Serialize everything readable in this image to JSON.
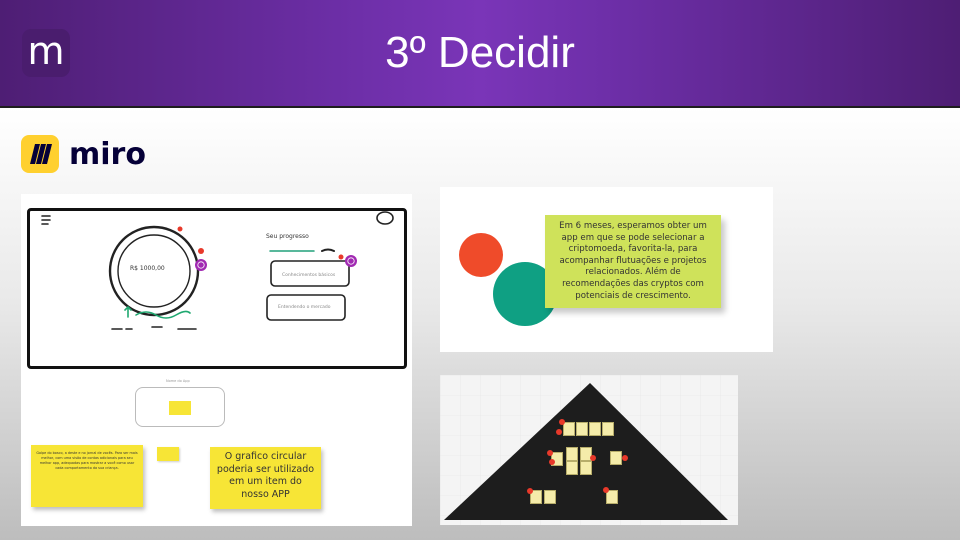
{
  "header": {
    "logo_letter": "m",
    "title": "3º Decidir"
  },
  "miro_logo": {
    "wordmark": "miro"
  },
  "wireframe": {
    "balance": "R$ 1000,00",
    "progress_label": "Seu progresso",
    "card1": "Conhecimentos básicos",
    "card2": "Entendendo o mercado",
    "mini_label": "Nome do App"
  },
  "sticky_notes": {
    "small_left": "Golpe do bosco, a deste e no jornal de vocês. Para ser mais melhor, com uma visão de contas adicionais para seu melhor app, adequadas para mostrar a você como usar cada comportamento da sua criança.",
    "grafico": "O grafico circular poderia ser utilizado em um item do nosso APP"
  },
  "green_note": {
    "text": "Em 6 meses, esperamos obter um app em que se pode selecionar a criptomoeda, favorita-la, para acompanhar flutuações e projetos relacionados. Além de recomendações das cryptos com potenciais de crescimento."
  },
  "colors": {
    "header_purple": "#6c2ea6",
    "circle_red": "#ef4b2a",
    "circle_teal": "#0fa083",
    "sticky_yellow": "#f7e536",
    "green_note": "#cfe25a",
    "triangle": "#1d1d1d"
  }
}
